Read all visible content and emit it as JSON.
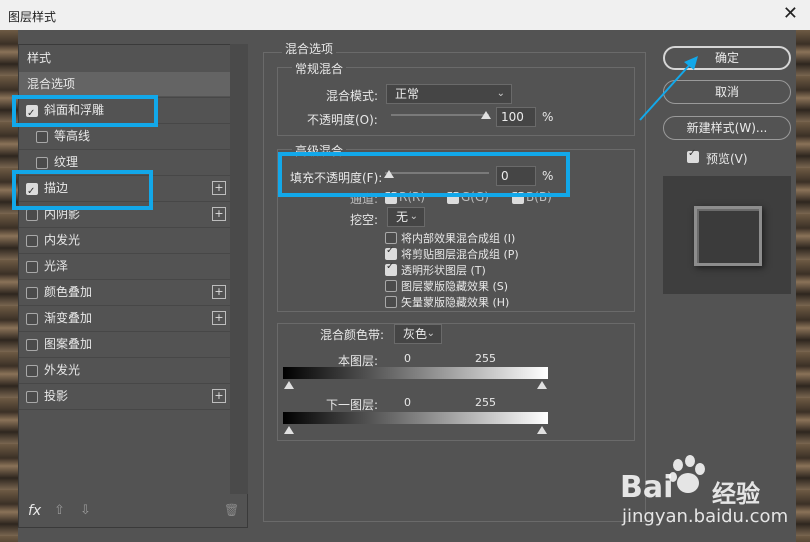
{
  "window": {
    "title": "图层样式",
    "close": "✕"
  },
  "left_panel": {
    "header": "样式",
    "items": [
      {
        "label": "混合选项",
        "checked": null,
        "plus": false,
        "selected": true
      },
      {
        "label": "斜面和浮雕",
        "checked": true,
        "plus": false
      },
      {
        "label": "等高线",
        "checked": false,
        "plus": false,
        "indent": true
      },
      {
        "label": "纹理",
        "checked": false,
        "plus": false,
        "indent": true
      },
      {
        "label": "描边",
        "checked": true,
        "plus": true
      },
      {
        "label": "内阴影",
        "checked": false,
        "plus": true
      },
      {
        "label": "内发光",
        "checked": false,
        "plus": false
      },
      {
        "label": "光泽",
        "checked": false,
        "plus": false
      },
      {
        "label": "颜色叠加",
        "checked": false,
        "plus": true
      },
      {
        "label": "渐变叠加",
        "checked": false,
        "plus": true
      },
      {
        "label": "图案叠加",
        "checked": false,
        "plus": false
      },
      {
        "label": "外发光",
        "checked": false,
        "plus": false
      },
      {
        "label": "投影",
        "checked": false,
        "plus": true
      }
    ],
    "plus_glyph": "+",
    "bottom": {
      "fx": "fx",
      "up": "⇧",
      "down": "⇩",
      "trash": "🗑"
    }
  },
  "main": {
    "section_title": "混合选项",
    "general": {
      "legend": "常规混合",
      "blend_mode_label": "混合模式:",
      "blend_mode_value": "正常",
      "opacity_label": "不透明度(O):",
      "opacity_value": "100",
      "opacity_unit": "%"
    },
    "advanced": {
      "legend": "高级混合",
      "fill_label": "填充不透明度(F):",
      "fill_value": "0",
      "fill_unit": "%",
      "channels_label": "通道:",
      "channels": [
        "R(R)",
        "G(G)",
        "B(B)"
      ],
      "knockout_label": "挖空:",
      "knockout_value": "无",
      "options": [
        {
          "label": "将内部效果混合成组 (I)",
          "checked": false
        },
        {
          "label": "将剪贴图层混合成组 (P)",
          "checked": true
        },
        {
          "label": "透明形状图层 (T)",
          "checked": true
        },
        {
          "label": "图层蒙版隐藏效果 (S)",
          "checked": false
        },
        {
          "label": "矢量蒙版隐藏效果 (H)",
          "checked": false
        }
      ]
    },
    "blend_if": {
      "label": "混合颜色带:",
      "value": "灰色",
      "this_layer_label": "本图层:",
      "this_low": "0",
      "this_high": "255",
      "underlying_label": "下一图层:",
      "under_low": "0",
      "under_high": "255"
    }
  },
  "right": {
    "ok": "确定",
    "cancel": "取消",
    "new_style": "新建样式(W)...",
    "preview_label": "预览(V)",
    "preview_checked": true
  },
  "watermark": {
    "brand": "Bai",
    "brand2": "经验",
    "url": "jingyan.baidu.com"
  },
  "colors": {
    "highlight": "#12a8ea",
    "dialog_bg": "#535353"
  }
}
